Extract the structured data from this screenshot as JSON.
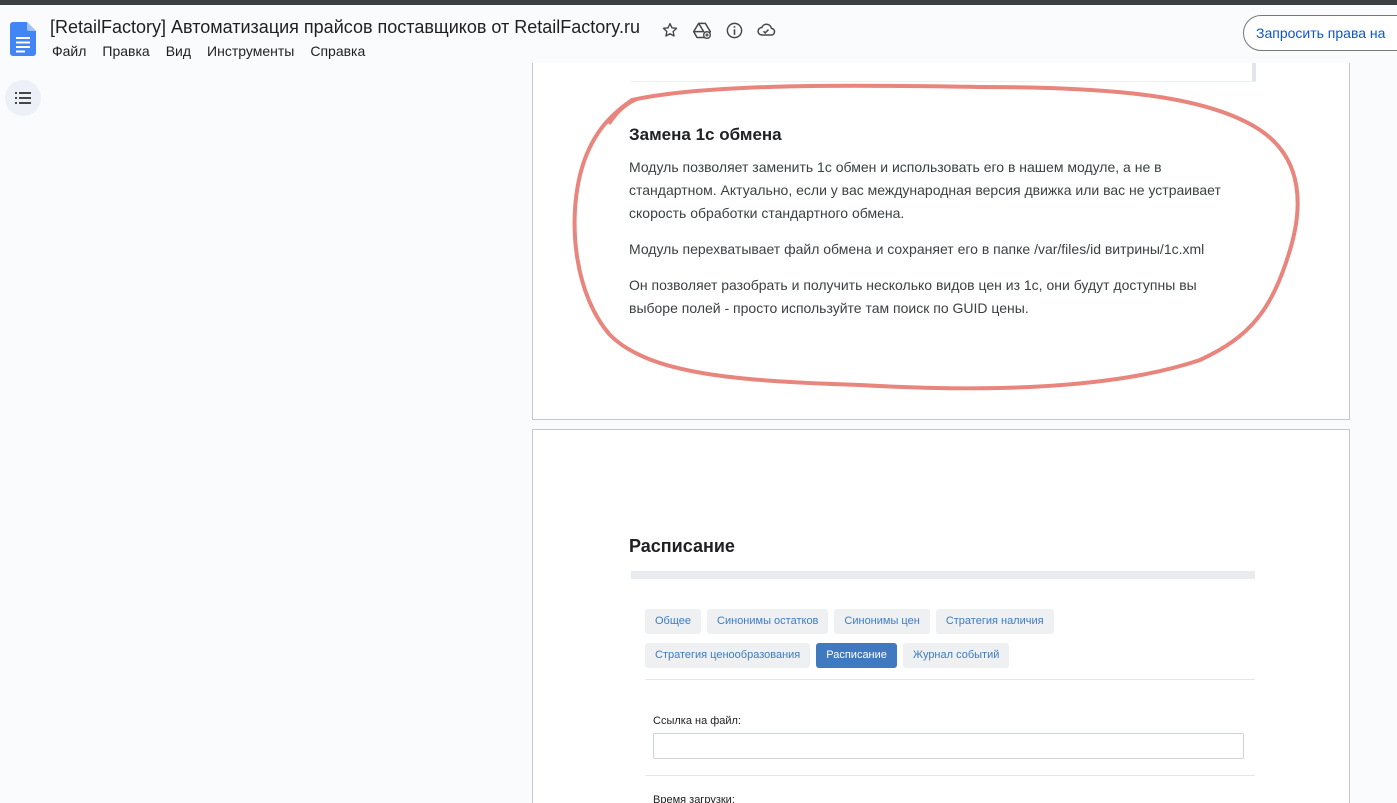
{
  "app": {
    "doc_title": "[RetailFactory] Автоматизация прайсов поставщиков от RetailFactory.ru",
    "request_access_label": "Запросить права на",
    "menu": [
      "Файл",
      "Правка",
      "Вид",
      "Инструменты",
      "Справка"
    ]
  },
  "icons": {
    "star": "star-icon",
    "move": "move-to-drive-icon",
    "info": "info-icon",
    "cloud": "cloud-status-icon",
    "outline": "document-outline-icon"
  },
  "colors": {
    "accent": "#0b57d0",
    "annotation": "#e8857d",
    "active_tab": "#3f7ac0"
  },
  "section_1c": {
    "heading": "Замена 1с обмена",
    "paragraphs": [
      "Модуль позволяет заменить 1с обмен и использовать его в нашем модуле, а не в стандартном. Актуально, если у вас международная версия движка или вас не устраивает скорость обработки стандартного обмена.",
      "Модуль перехватывает файл обмена и сохраняет его в папке /var/files/id витрины/1c.xml",
      "Он позволяет разобрать и получить несколько видов цен из 1с, они будут доступны вы выборе полей - просто используйте там поиск по GUID цены."
    ]
  },
  "section_schedule": {
    "heading": "Расписание",
    "tabs_row1": [
      "Общее",
      "Синонимы остатков",
      "Синонимы цен",
      "Стратегия наличия"
    ],
    "tabs_row2": [
      "Стратегия ценообразования",
      "Расписание",
      "Журнал событий"
    ],
    "active_tab": "Расписание",
    "file_link_label": "Ссылка на файл:",
    "file_link_value": "",
    "load_time_label": "Время загрузки:"
  }
}
